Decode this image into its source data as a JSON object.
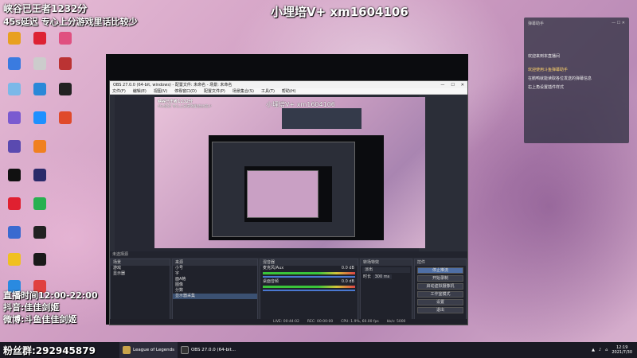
{
  "stream_overlay": {
    "line1": "峡谷已王者1232分",
    "line2": "45s延迟 专心上分游戏里话比较少",
    "title": "小埋培V+ xm1604106",
    "schedule": "直播时间12:00-22:00",
    "douyin": "抖音:佳佳剑姬",
    "weibo": "微博:斗鱼佳佳剑姬",
    "fans_group": "粉丝群:292945879"
  },
  "obs": {
    "window_title": "OBS 27.0.0 (64-bit, windows) - 配置文件: 未命名 - 场景: 未命名",
    "menu": [
      "文件(F)",
      "编辑(E)",
      "视图(V)",
      "停靠窗口(D)",
      "配置文件(P)",
      "场景集合(S)",
      "工具(T)",
      "帮助(H)"
    ],
    "panel_headers": {
      "transition_label": "未选择源",
      "scenes": "场景",
      "sources": "来源",
      "mixer": "混音器",
      "transitions": "转场特效",
      "controls": "控件"
    },
    "scenes": [
      "游戏",
      "显示器"
    ],
    "sources": [
      "小号",
      "字",
      "面A格",
      "图像",
      "分数",
      "显示器采集"
    ],
    "mixer": [
      {
        "name": "麦克风/Aux",
        "db": "0.0 dB"
      },
      {
        "name": "桌面音频",
        "db": "0.0 dB"
      }
    ],
    "transition": {
      "type": "淡出",
      "duration_label": "时长",
      "duration": "300 ms"
    },
    "controls": [
      "停止推流",
      "开始录制",
      "启动虚拟摄像机",
      "工作室模式",
      "设置",
      "退出"
    ],
    "status": {
      "lost_frames": "LIVE: 00:44:02",
      "rec": "REC: 00:00:00",
      "cpu": "CPU: 1.9%, 60.00 fps",
      "bitrate": "kb/s: 5000"
    }
  },
  "chat": {
    "header": "弹幕助手",
    "messages": [
      {
        "text": "欢迎来到本直播间",
        "highlight": false
      },
      {
        "text": "欢迎使用斗鱼弹幕助手",
        "highlight": true
      },
      {
        "text": "在鹅鸭就能读取各位发送的弹幕信息",
        "highlight": false
      },
      {
        "text": "右上角设置插件样式",
        "highlight": false
      }
    ]
  },
  "taskbar": {
    "items": [
      {
        "label": "League of Legends",
        "icon": "league-icon",
        "color": "#c8a44a"
      },
      {
        "label": "OBS 27.0.0 (64-bit...",
        "icon": "obs-icon",
        "color": "#333333"
      }
    ],
    "clock_time": "12:19",
    "clock_date": "2021/7/30"
  },
  "colors": {
    "accent": "#4a78d1",
    "chat_highlight": "#ffd46a"
  }
}
